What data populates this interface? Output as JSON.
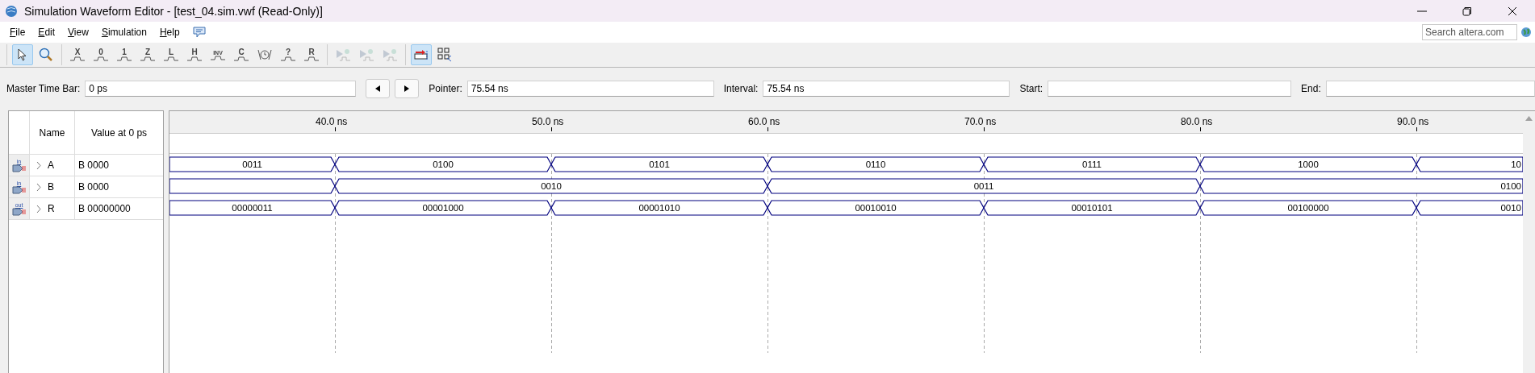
{
  "window": {
    "title": "Simulation Waveform Editor - [test_04.sim.vwf (Read-Only)]"
  },
  "menu": [
    "File",
    "Edit",
    "View",
    "Simulation",
    "Help"
  ],
  "search": {
    "placeholder": "Search altera.com"
  },
  "toolbar": {
    "groups": [
      {
        "tools": [
          {
            "kind": "pointer",
            "selected": true,
            "disabled": false
          },
          {
            "kind": "zoom",
            "selected": false,
            "disabled": false
          }
        ]
      },
      {
        "tools": [
          {
            "kind": "value",
            "label": "X",
            "selected": false,
            "disabled": false
          },
          {
            "kind": "value",
            "label": "0",
            "selected": false,
            "disabled": false
          },
          {
            "kind": "value",
            "label": "1",
            "selected": false,
            "disabled": false
          },
          {
            "kind": "value",
            "label": "Z",
            "selected": false,
            "disabled": false
          },
          {
            "kind": "value",
            "label": "L",
            "selected": false,
            "disabled": false
          },
          {
            "kind": "value",
            "label": "H",
            "selected": false,
            "disabled": false
          },
          {
            "kind": "value",
            "label": "INV",
            "selected": false,
            "disabled": false
          },
          {
            "kind": "value",
            "label": "C",
            "selected": false,
            "disabled": false
          },
          {
            "kind": "clock",
            "selected": false,
            "disabled": false
          },
          {
            "kind": "value",
            "label": "?",
            "selected": false,
            "disabled": false
          },
          {
            "kind": "value",
            "label": "R",
            "selected": false,
            "disabled": false
          }
        ]
      },
      {
        "tools": [
          {
            "kind": "run",
            "selected": false,
            "disabled": true
          },
          {
            "kind": "run",
            "selected": false,
            "disabled": true
          },
          {
            "kind": "run",
            "selected": false,
            "disabled": true
          }
        ]
      },
      {
        "tools": [
          {
            "kind": "snap",
            "selected": true,
            "disabled": false
          },
          {
            "kind": "grid",
            "selected": false,
            "disabled": false
          }
        ]
      }
    ]
  },
  "time_bar": {
    "master": {
      "label": "Master Time Bar:",
      "value": "0 ps"
    },
    "pointer": {
      "label": "Pointer:",
      "value": "75.54 ns"
    },
    "interval": {
      "label": "Interval:",
      "value": "75.54 ns"
    },
    "start": {
      "label": "Start:"
    },
    "end": {
      "label": "End:"
    }
  },
  "table": {
    "columns": [
      "Name",
      "Value at 0 ps"
    ],
    "rows": [
      {
        "direction": "in",
        "name": "A",
        "value": "B 0000",
        "expanded": false,
        "wave": [
          {
            "value": "0011",
            "long": false
          },
          {
            "value": "0100",
            "long": false
          },
          {
            "value": "0101",
            "long": false
          },
          {
            "value": "0110",
            "long": false
          },
          {
            "value": "0111",
            "long": false
          },
          {
            "value": "1000",
            "long": false
          },
          {
            "value": "10",
            "long": false
          }
        ]
      },
      {
        "direction": "in",
        "name": "B",
        "value": "B 0000",
        "expanded": false,
        "wave": [
          {
            "long": false
          },
          {
            "value": "0010",
            "long": true
          },
          {
            "value": "0011",
            "long": true
          },
          {
            "value": "0100",
            "long": true
          }
        ]
      },
      {
        "direction": "out",
        "name": "R",
        "value": "B 00000000",
        "expanded": false,
        "wave": [
          {
            "value": "00000011",
            "long": false
          },
          {
            "value": "00001000",
            "long": false
          },
          {
            "value": "00001010",
            "long": false
          },
          {
            "value": "00010010",
            "long": false
          },
          {
            "value": "00010101",
            "long": false
          },
          {
            "value": "00100000",
            "long": false
          },
          {
            "value": "0010",
            "long": false
          }
        ]
      }
    ]
  },
  "ruler": {
    "ticks": [
      "40.0 ns",
      "50.0 ns",
      "60.0 ns",
      "70.0 ns",
      "80.0 ns",
      "90.0 ns"
    ]
  }
}
